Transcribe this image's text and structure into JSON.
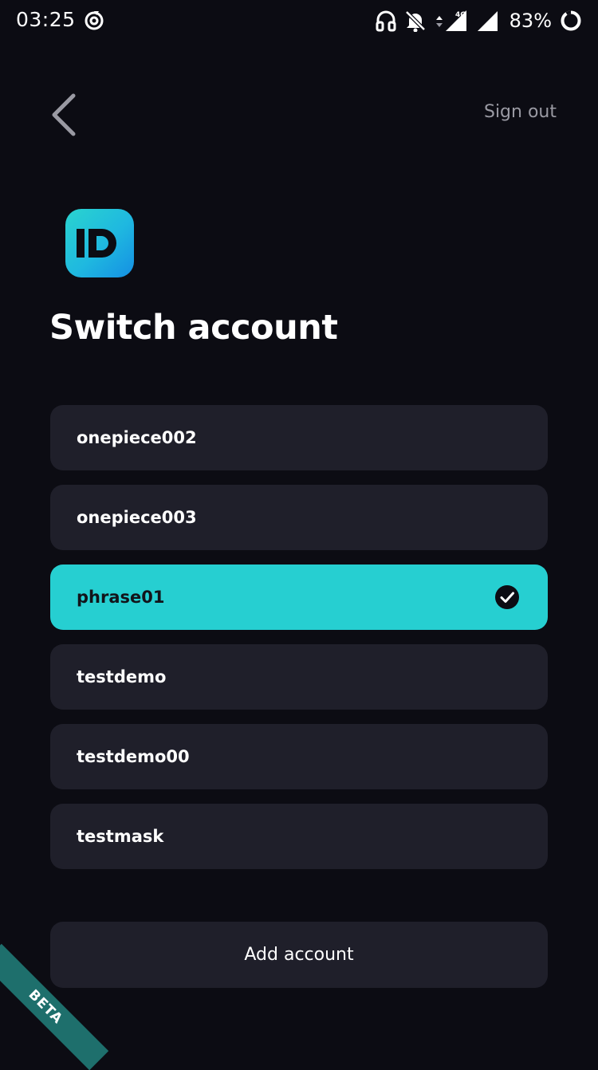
{
  "status_bar": {
    "time": "03:25",
    "network_type": "4G",
    "battery_percent": "83%",
    "icons": [
      "sync-icon",
      "headphones-icon",
      "bell-off-icon",
      "data-arrows-icon",
      "signal-icon",
      "signal-icon",
      "battery-ring-icon"
    ]
  },
  "header": {
    "back_icon": "chevron-left-icon",
    "sign_out_label": "Sign out"
  },
  "logo": {
    "icon": "id-logo-icon",
    "text": "ID",
    "gradient": [
      "#2ad4cf",
      "#158fe3"
    ]
  },
  "title": "Switch account",
  "accounts": [
    {
      "label": "onepiece002",
      "selected": false
    },
    {
      "label": "onepiece003",
      "selected": false
    },
    {
      "label": "phrase01",
      "selected": true
    },
    {
      "label": "testdemo",
      "selected": false
    },
    {
      "label": "testdemo00",
      "selected": false
    },
    {
      "label": "testmask",
      "selected": false
    }
  ],
  "add_account_label": "Add account",
  "beta_label": "BETA",
  "colors": {
    "background": "#0c0c13",
    "card": "#1f1f2a",
    "accent": "#26cfd1",
    "ribbon": "#1e6f6c",
    "muted_text": "#9a9aa3"
  }
}
